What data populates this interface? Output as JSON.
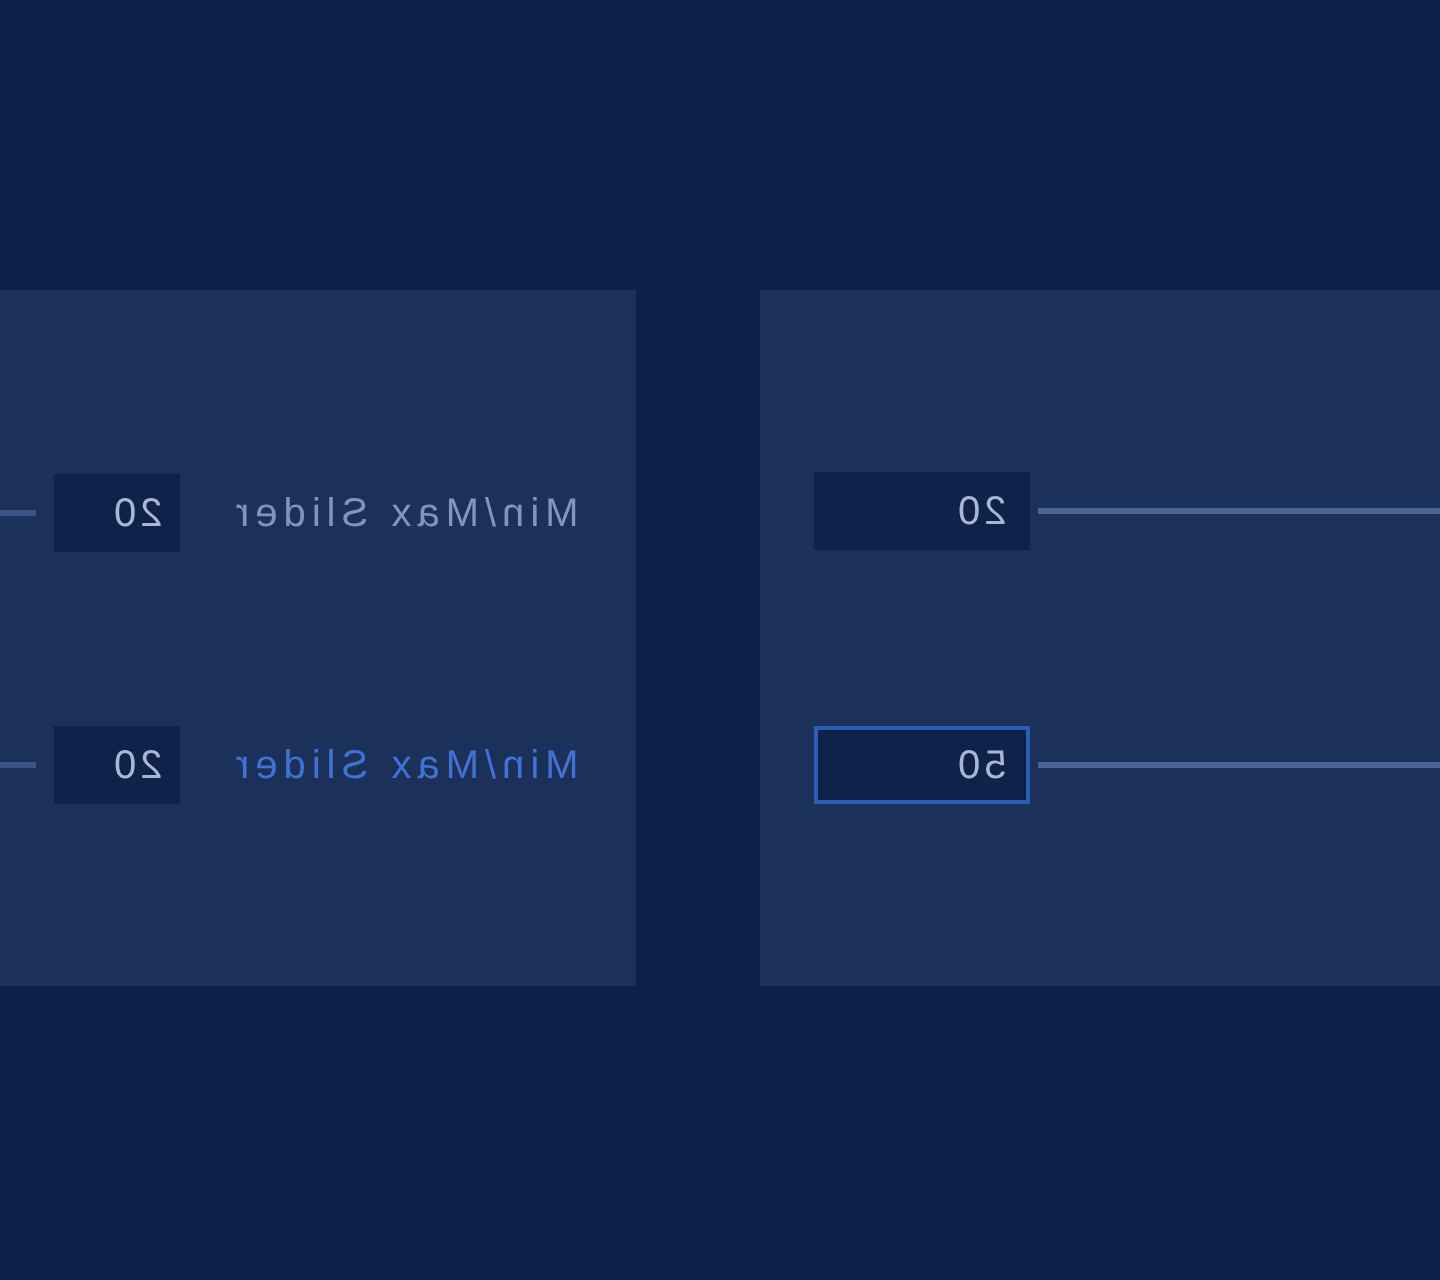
{
  "panels": [
    {
      "rows": [
        {
          "label": "Min/Max Slider",
          "label_active": false,
          "value": "20"
        },
        {
          "label": "Min/Max Slider",
          "label_active": true,
          "value": "20"
        }
      ]
    },
    {
      "rows": [
        {
          "value": "20",
          "focused": false
        },
        {
          "value": "50",
          "focused": true
        }
      ]
    }
  ]
}
